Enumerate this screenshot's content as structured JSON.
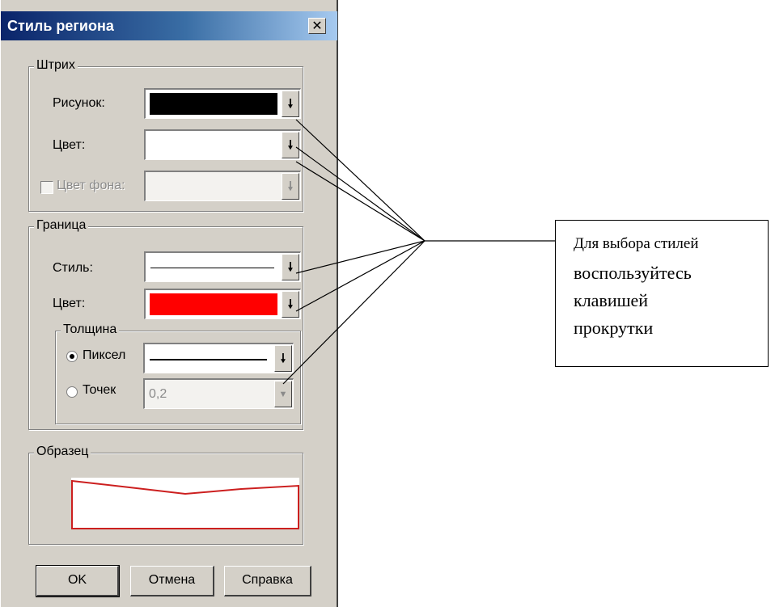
{
  "dialog": {
    "title": "Стиль региона",
    "close_glyph": "✕"
  },
  "stroke_group": {
    "legend": "Штрих",
    "pattern_label": "Рисунок:",
    "pattern_value_color": "#000000",
    "color_label": "Цвет:",
    "color_value_color": "#ffffff",
    "bg_color_label": "Цвет фона:",
    "bg_color_checked": false
  },
  "border_group": {
    "legend": "Граница",
    "style_label": "Стиль:",
    "color_label": "Цвет:",
    "color_value_color": "#ff0000",
    "thickness": {
      "legend": "Толщина",
      "pixel_label": "Пиксел",
      "pixel_selected": true,
      "points_label": "Точек",
      "points_value": "0,2"
    }
  },
  "sample_group": {
    "legend": "Образец",
    "border_color": "#cc1f1f"
  },
  "buttons": {
    "ok": "OK",
    "cancel": "Отмена",
    "help": "Справка"
  },
  "dropdown_glyph": "🠗",
  "callout": {
    "line1": "Для выбора стилей",
    "line2": "воспользуйтесь",
    "line3": "клавишей",
    "line4": "прокрутки"
  }
}
